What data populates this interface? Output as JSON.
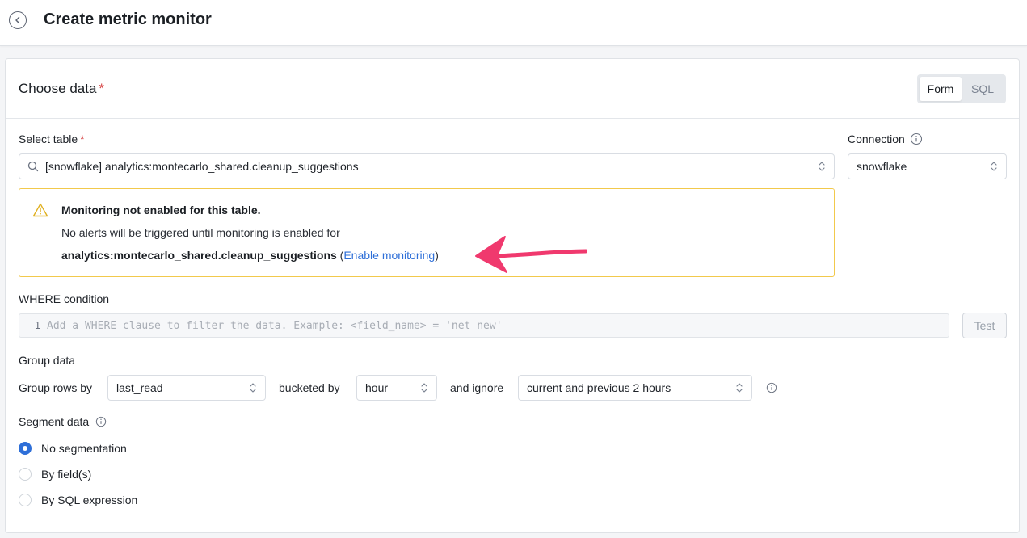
{
  "header": {
    "title": "Create metric monitor"
  },
  "choose_data": {
    "title": "Choose data",
    "required_mark": "*",
    "mode_toggle": {
      "form": "Form",
      "sql": "SQL",
      "selected": "Form"
    }
  },
  "select_table": {
    "label": "Select table",
    "required_mark": "*",
    "value": "[snowflake] analytics:montecarlo_shared.cleanup_suggestions"
  },
  "connection": {
    "label": "Connection",
    "value": "snowflake"
  },
  "warning": {
    "title": "Monitoring not enabled for this table.",
    "message": "No alerts will be triggered until monitoring is enabled for",
    "table_name": "analytics:montecarlo_shared.cleanup_suggestions",
    "paren_open": "(",
    "link": "Enable monitoring",
    "paren_close": ")",
    "accent_color": "#f2c94c"
  },
  "where": {
    "label": "WHERE condition",
    "line_number": "1",
    "placeholder": "Add a WHERE clause to filter the data. Example: <field_name> = 'net new'",
    "test_button": "Test"
  },
  "group": {
    "label": "Group data",
    "rows_by_label": "Group rows by",
    "rows_by_value": "last_read",
    "bucketed_label": "bucketed by",
    "bucketed_value": "hour",
    "ignore_label": "and ignore",
    "ignore_value": "current and previous 2 hours"
  },
  "segment": {
    "label": "Segment data",
    "options": [
      {
        "label": "No segmentation",
        "selected": true
      },
      {
        "label": "By field(s)",
        "selected": false
      },
      {
        "label": "By SQL expression",
        "selected": false
      }
    ]
  },
  "colors": {
    "accent": "#2e6fd8",
    "required": "#d43b3b"
  }
}
